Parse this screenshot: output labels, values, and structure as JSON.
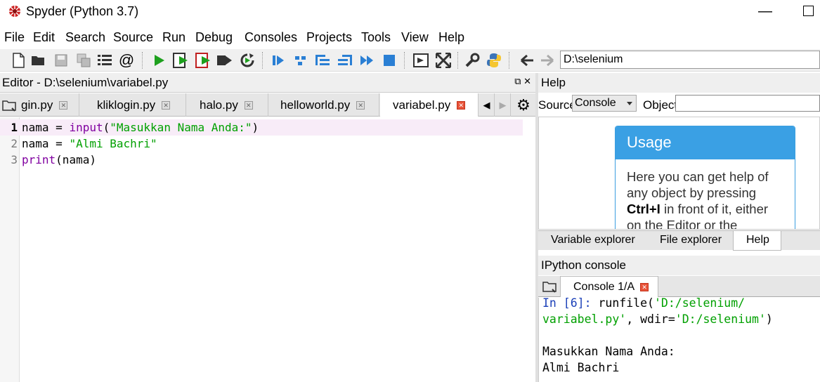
{
  "window": {
    "title": "Spyder (Python 3.7)",
    "minimize_glyph": "—"
  },
  "menu": [
    "File",
    "Edit",
    "Search",
    "Source",
    "Run",
    "Debug",
    "Consoles",
    "Projects",
    "Tools",
    "View",
    "Help"
  ],
  "toolbar": {
    "path": "D:\\selenium",
    "icons": [
      "new-file-icon",
      "open-folder-icon",
      "save-icon",
      "save-all-icon",
      "outline-icon",
      "at-icon",
      "run-icon",
      "run-cell-icon",
      "run-cell-advance-icon",
      "run-selection-icon",
      "rerun-icon",
      "debug-icon",
      "step-icon",
      "step-into-icon",
      "step-return-icon",
      "continue-icon",
      "stop-icon",
      "maximize-pane-icon",
      "fullscreen-icon",
      "wrench-icon",
      "python-path-icon",
      "back-arrow-icon",
      "forward-arrow-icon"
    ]
  },
  "editor": {
    "header": "Editor - D:\\selenium\\variabel.py",
    "header_buttons": "⧉ ✕",
    "tabs": [
      "gin.py",
      "kliklogin.py",
      "halo.py",
      "helloworld.py",
      "variabel.py"
    ],
    "active_tab": "variabel.py",
    "line_numbers": [
      "1",
      "2",
      "3"
    ],
    "lines": [
      {
        "var": "nama",
        "eq": " = ",
        "func": "input",
        "open": "(",
        "str": "\"Masukkan Nama Anda:\"",
        "close": ")"
      },
      {
        "var": "nama",
        "eq": " = ",
        "str": "\"Almi Bachri\""
      },
      {
        "func": "print",
        "rest": "(nama)"
      }
    ]
  },
  "help": {
    "header": "Help",
    "source_label": "Source",
    "source_value": "Console",
    "object_label": "Object",
    "usage_title": "Usage",
    "usage_text_1": "Here you can get help of any object by pressing ",
    "usage_key": "Ctrl+I",
    "usage_text_2": " in front of it, either on the Editor or the"
  },
  "pane_tabs": [
    "Variable explorer",
    "File explorer",
    "Help"
  ],
  "active_pane_tab": "Help",
  "ipython": {
    "header": "IPython console",
    "tab": "Console 1/A",
    "prompt": "In [6]:",
    "cmd_1": " runfile(",
    "arg_1a": "'D:/selenium/",
    "arg_1b": "variabel.py'",
    "cmd_2": ", wdir=",
    "arg_2": "'D:/selenium'",
    "cmd_3": ")",
    "output_1": "Masukkan Nama Anda:",
    "output_2": "Almi Bachri"
  },
  "colors": {
    "keyword": "#8000a0",
    "string": "#00a000",
    "prompt": "#1a3fb8",
    "usage_accent": "#3aa0e4",
    "close_red": "#e8543a"
  }
}
